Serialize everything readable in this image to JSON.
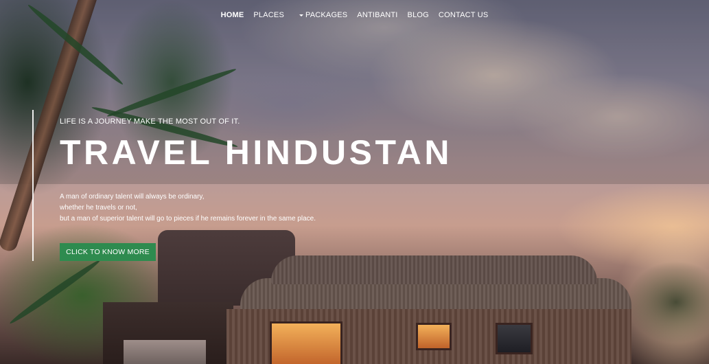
{
  "nav": {
    "items": [
      {
        "label": "HOME",
        "active": true
      },
      {
        "label": "PLACES",
        "active": false
      },
      {
        "label": "PACKAGES",
        "active": false,
        "dropdown": true
      },
      {
        "label": "ANTIBANTI",
        "active": false
      },
      {
        "label": "BLOG",
        "active": false
      },
      {
        "label": "CONTACT US",
        "active": false
      }
    ]
  },
  "hero": {
    "tagline": "LIFE IS A JOURNEY MAKE THE MOST OUT OF IT.",
    "title": "TRAVEL HINDUSTAN",
    "quote_lines": [
      "A man of ordinary talent will always be ordinary,",
      "whether he travels or not,",
      "but a man of superior talent will go to pieces if he remains forever in the same place."
    ],
    "cta_label": "CLICK TO KNOW MORE"
  },
  "colors": {
    "cta_background": "#2e8b4f",
    "text": "#ffffff"
  },
  "icons": {
    "dropdown": "caret-down-icon"
  }
}
